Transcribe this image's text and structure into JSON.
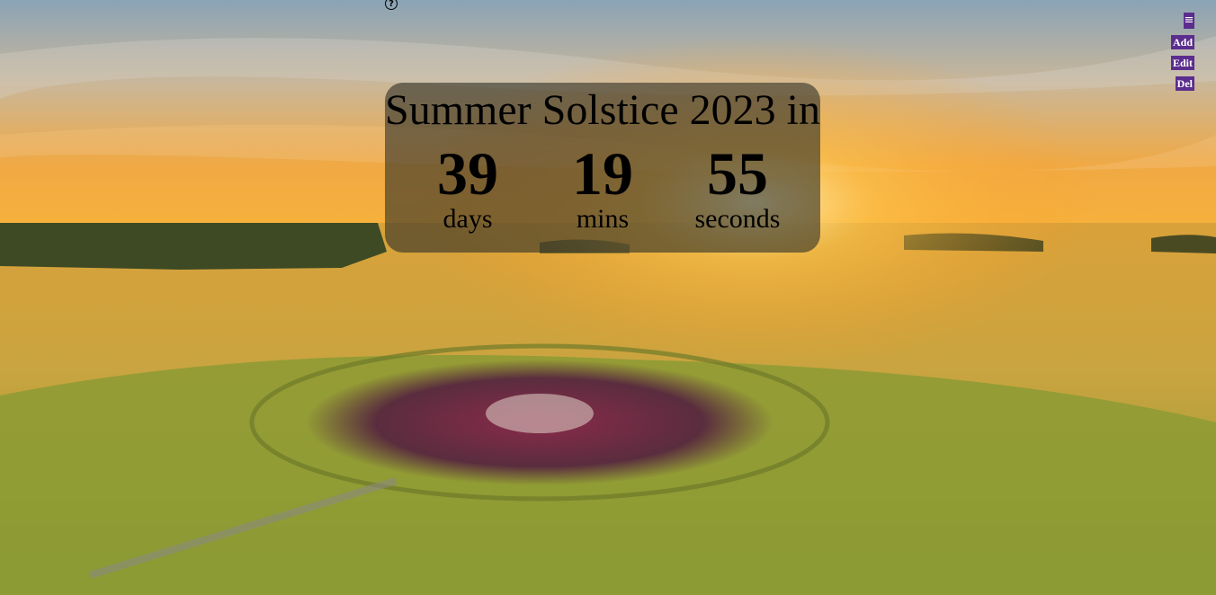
{
  "background": {
    "scene": "aerial-stonehenge-solstice-sunset",
    "sky_colors": [
      "#7f9cb0",
      "#f3a33a"
    ],
    "field_color": "#c9a23a",
    "grass_color": "#7e9a33"
  },
  "help": {
    "icon": "help-circle-icon",
    "glyph": "?"
  },
  "controls": {
    "menu_glyph": "≡",
    "add_label": "Add",
    "edit_label": "Edit",
    "delete_label": "Del",
    "accent": "#5b2d8e"
  },
  "countdown": {
    "title": "Summer Solstice 2023 in",
    "units": [
      {
        "value": "39",
        "label": "days"
      },
      {
        "value": "19",
        "label": "mins"
      },
      {
        "value": "55",
        "label": "seconds"
      }
    ]
  }
}
